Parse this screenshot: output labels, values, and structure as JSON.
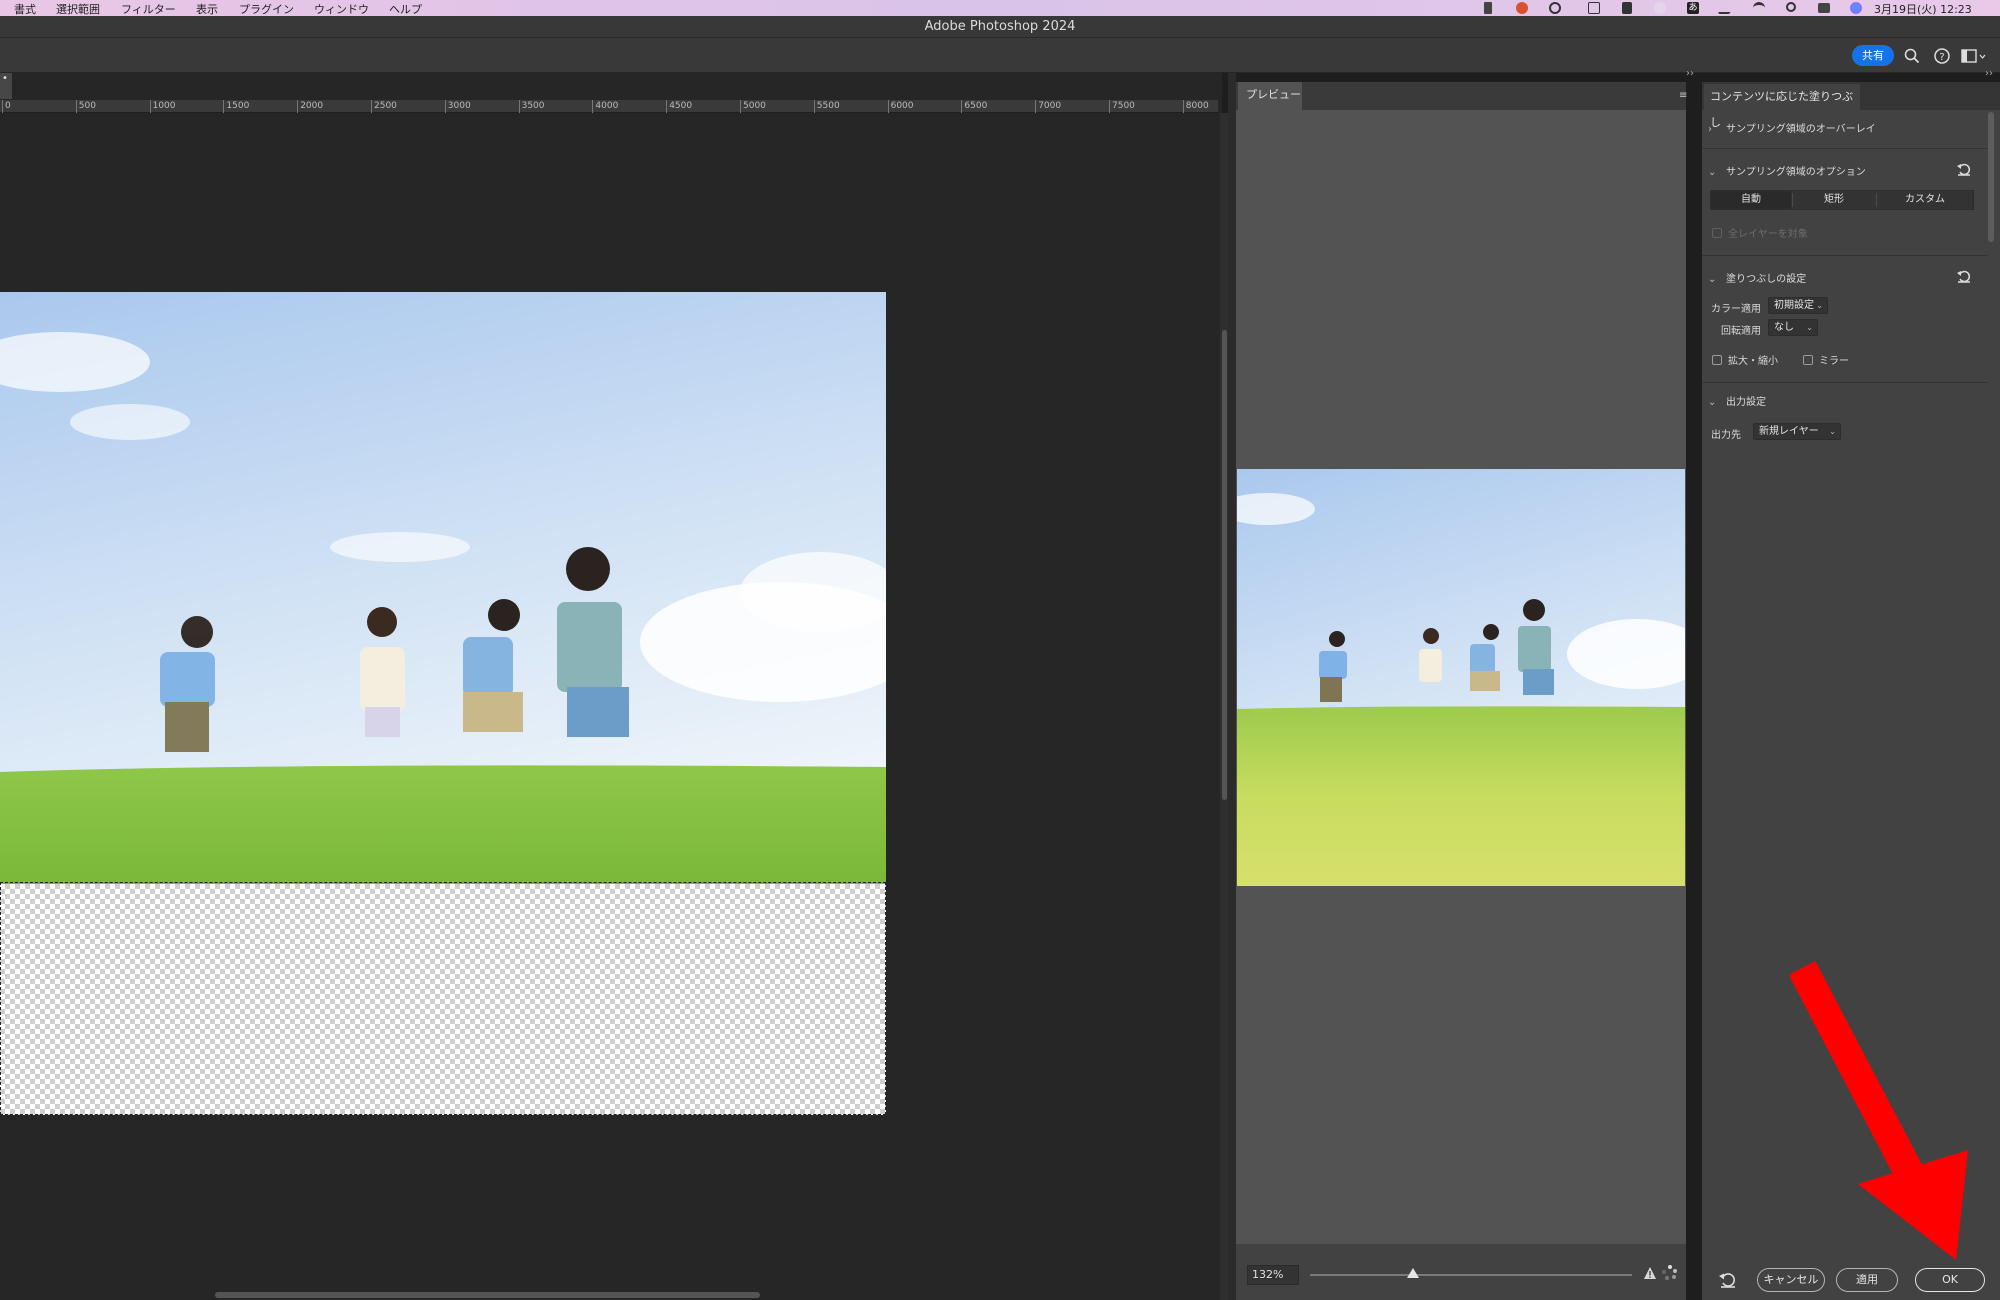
{
  "menubar": {
    "items": [
      "書式",
      "選択範囲",
      "フィルター",
      "表示",
      "プラグイン",
      "ウィンドウ",
      "ヘルプ"
    ],
    "clock": "3月19日(火)  12:23"
  },
  "window": {
    "title": "Adobe Photoshop 2024",
    "share_label": "共有"
  },
  "document": {
    "tab_label": "•",
    "ruler_ticks": [
      "0",
      "500",
      "1000",
      "1500",
      "2000",
      "2500",
      "3000",
      "3500",
      "4000",
      "4500",
      "5000",
      "5500",
      "6000",
      "6500",
      "7000",
      "7500",
      "8000"
    ]
  },
  "preview": {
    "tab_label": "プレビュー",
    "zoom_value": "132%",
    "menu_glyph": "≡"
  },
  "panel": {
    "tab_label": "コンテンツに応じた塗りつぶし",
    "sections": {
      "overlay": {
        "title": "サンプリング領域のオーバーレイ"
      },
      "sampling": {
        "title": "サンプリング領域のオプション",
        "segments": [
          "自動",
          "矩形",
          "カスタム"
        ],
        "active_segment": "自動",
        "all_layers_label": "全レイヤーを対象"
      },
      "fill": {
        "title": "塗りつぶしの設定",
        "color_label": "カラー適用",
        "color_value": "初期設定",
        "rotation_label": "回転適用",
        "rotation_value": "なし",
        "scale_label": "拡大・縮小",
        "mirror_label": "ミラー"
      },
      "output": {
        "title": "出力設定",
        "output_label": "出力先",
        "output_value": "新規レイヤー"
      }
    },
    "buttons": {
      "cancel": "キャンセル",
      "apply": "適用",
      "ok": "OK"
    }
  },
  "colors": {
    "accent_share": "#1473e6",
    "annotation_arrow": "#ff0000",
    "panel_bg": "#424242",
    "canvas_bg": "#262626"
  },
  "icons": [
    "search-icon",
    "help-icon",
    "workspace-icon",
    "reset-icon",
    "warning-icon",
    "loading-icon",
    "chevron-right-icon",
    "chevron-down-icon"
  ]
}
